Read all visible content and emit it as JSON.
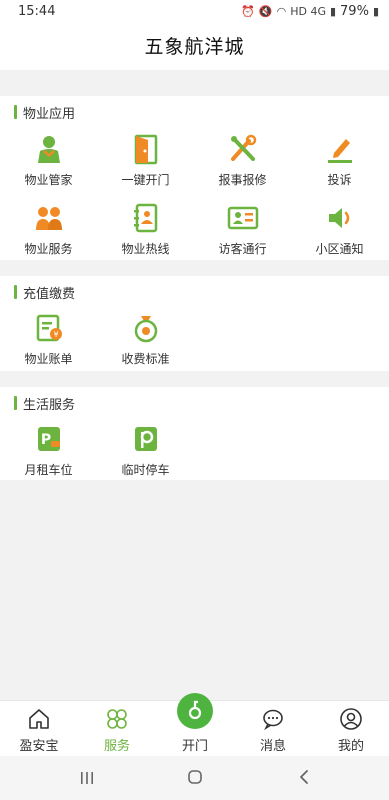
{
  "status": {
    "time": "15:44",
    "battery": "79%",
    "network": "HD 4G"
  },
  "header": {
    "title": "五象航洋城"
  },
  "sections": [
    {
      "title": "物业应用",
      "items": [
        {
          "label": "物业管家",
          "icon": "butler-icon"
        },
        {
          "label": "一键开门",
          "icon": "door-icon"
        },
        {
          "label": "报事报修",
          "icon": "tools-icon"
        },
        {
          "label": "投诉",
          "icon": "pen-icon"
        },
        {
          "label": "物业服务",
          "icon": "people-icon"
        },
        {
          "label": "物业热线",
          "icon": "phonebook-icon"
        },
        {
          "label": "访客通行",
          "icon": "id-card-icon"
        },
        {
          "label": "小区通知",
          "icon": "speaker-icon"
        }
      ]
    },
    {
      "title": "充值缴费",
      "items": [
        {
          "label": "物业账单",
          "icon": "bill-icon"
        },
        {
          "label": "收费标准",
          "icon": "money-bag-icon"
        }
      ]
    },
    {
      "title": "生活服务",
      "items": [
        {
          "label": "月租车位",
          "icon": "parking-car-icon"
        },
        {
          "label": "临时停车",
          "icon": "parking-icon"
        }
      ]
    }
  ],
  "tabbar": [
    {
      "label": "盈安宝",
      "icon": "home-icon"
    },
    {
      "label": "服务",
      "icon": "clover-icon",
      "active": true
    },
    {
      "label": "开门",
      "icon": "key-icon"
    },
    {
      "label": "消息",
      "icon": "chat-icon"
    },
    {
      "label": "我的",
      "icon": "user-icon"
    }
  ],
  "colors": {
    "accent": "#6db33f",
    "orange": "#f08a24",
    "green": "#6db33f"
  }
}
